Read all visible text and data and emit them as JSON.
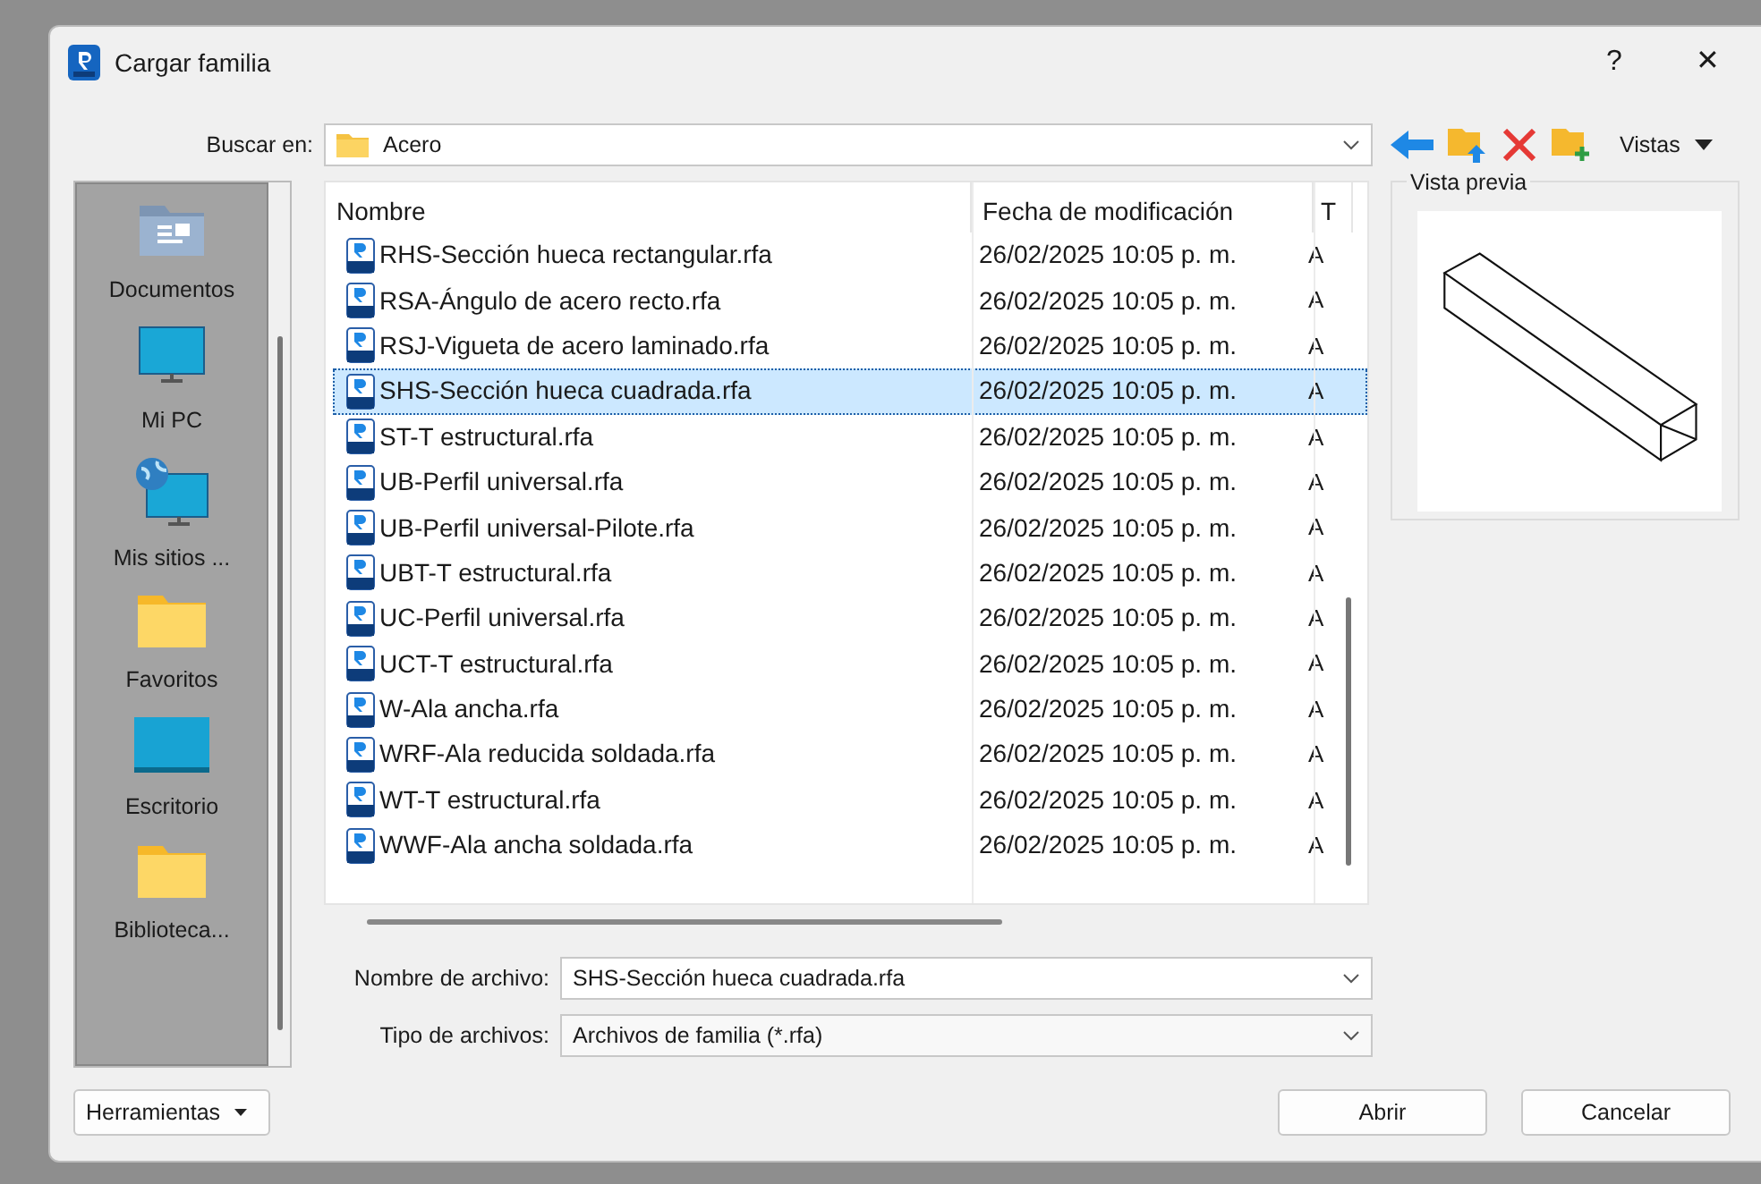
{
  "window": {
    "title": "Cargar familia",
    "help": "?",
    "close": "✕"
  },
  "look_in": {
    "label": "Buscar en:",
    "value": "Acero"
  },
  "toolbar": {
    "views": "Vistas"
  },
  "places": [
    {
      "label": "Documentos",
      "kind": "documents"
    },
    {
      "label": "Mi PC",
      "kind": "pc"
    },
    {
      "label": "Mis sitios ...",
      "kind": "network"
    },
    {
      "label": "Favoritos",
      "kind": "folder"
    },
    {
      "label": "Escritorio",
      "kind": "desktop"
    },
    {
      "label": "Biblioteca...",
      "kind": "folder"
    }
  ],
  "file_list": {
    "columns": [
      "Nombre",
      "Fecha de modificación",
      "T"
    ],
    "rows": [
      {
        "name": "RHS-Sección hueca rectangular.rfa",
        "date": "26/02/2025 10:05 p. m.",
        "column_3": "A",
        "selected": false
      },
      {
        "name": "RSA-Ángulo de acero recto.rfa",
        "date": "26/02/2025 10:05 p. m.",
        "column_3": "A",
        "selected": false
      },
      {
        "name": "RSJ-Vigueta de acero laminado.rfa",
        "date": "26/02/2025 10:05 p. m.",
        "column_3": "A",
        "selected": false
      },
      {
        "name": "SHS-Sección hueca cuadrada.rfa",
        "date": "26/02/2025 10:05 p. m.",
        "column_3": "A",
        "selected": true
      },
      {
        "name": "ST-T estructural.rfa",
        "date": "26/02/2025 10:05 p. m.",
        "column_3": "A",
        "selected": false
      },
      {
        "name": "UB-Perfil universal.rfa",
        "date": "26/02/2025 10:05 p. m.",
        "column_3": "A",
        "selected": false
      },
      {
        "name": "UB-Perfil universal-Pilote.rfa",
        "date": "26/02/2025 10:05 p. m.",
        "column_3": "A",
        "selected": false
      },
      {
        "name": "UBT-T estructural.rfa",
        "date": "26/02/2025 10:05 p. m.",
        "column_3": "A",
        "selected": false
      },
      {
        "name": "UC-Perfil universal.rfa",
        "date": "26/02/2025 10:05 p. m.",
        "column_3": "A",
        "selected": false
      },
      {
        "name": "UCT-T estructural.rfa",
        "date": "26/02/2025 10:05 p. m.",
        "column_3": "A",
        "selected": false
      },
      {
        "name": "W-Ala ancha.rfa",
        "date": "26/02/2025 10:05 p. m.",
        "column_3": "A",
        "selected": false
      },
      {
        "name": "WRF-Ala reducida soldada.rfa",
        "date": "26/02/2025 10:05 p. m.",
        "column_3": "A",
        "selected": false
      },
      {
        "name": "WT-T estructural.rfa",
        "date": "26/02/2025 10:05 p. m.",
        "column_3": "A",
        "selected": false
      },
      {
        "name": "WWF-Ala ancha soldada.rfa",
        "date": "26/02/2025 10:05 p. m.",
        "column_3": "A",
        "selected": false
      }
    ]
  },
  "preview": {
    "title": "Vista previa"
  },
  "file_name": {
    "label": "Nombre de archivo:",
    "value": "SHS-Sección hueca cuadrada.rfa"
  },
  "file_type": {
    "label": "Tipo de archivos:",
    "value": "Archivos de familia (*.rfa)"
  },
  "buttons": {
    "tools": "Herramientas",
    "open": "Abrir",
    "cancel": "Cancelar"
  }
}
